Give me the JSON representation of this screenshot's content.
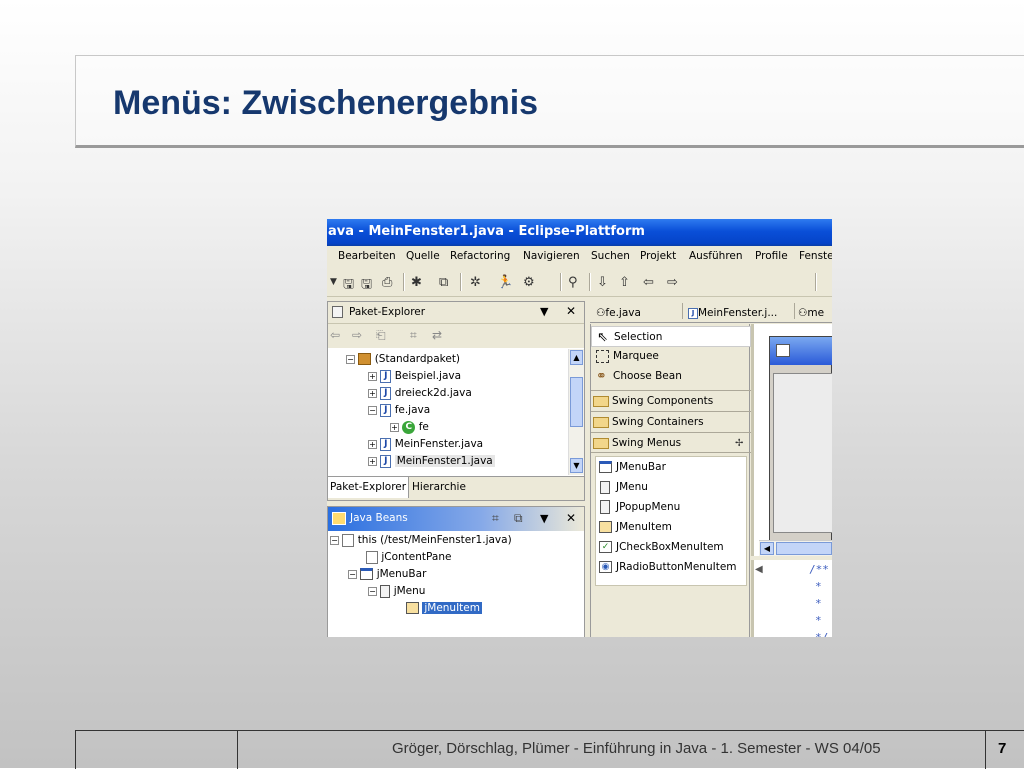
{
  "slide": {
    "title": "Menüs: Zwischenergebnis",
    "footer": "Gröger, Dörschlag, Plümer -  Einführung in Java  -  1. Semester  -  WS 04/05",
    "page_number": "7"
  },
  "eclipse": {
    "window_title": "ava - MeinFenster1.java - Eclipse-Plattform",
    "menu": [
      "Bearbeiten",
      "Quelle",
      "Refactoring",
      "Navigieren",
      "Suchen",
      "Projekt",
      "Ausführen",
      "Profile",
      "Fenste"
    ],
    "package_explorer": {
      "title": "Paket-Explorer",
      "tree": [
        {
          "label": "(Standardpaket)",
          "expander": "−",
          "icon": "package-icon"
        },
        {
          "label": "Beispiel.java",
          "expander": "+",
          "icon": "java-file-icon"
        },
        {
          "label": "dreieck2d.java",
          "expander": "+",
          "icon": "java-file-icon"
        },
        {
          "label": "fe.java",
          "expander": "−",
          "icon": "java-file-icon"
        },
        {
          "label": "fe",
          "expander": "+",
          "icon": "class-icon"
        },
        {
          "label": "MeinFenster.java",
          "expander": "+",
          "icon": "java-file-icon"
        },
        {
          "label": "MeinFenster1.java",
          "expander": "+",
          "icon": "java-file-icon"
        }
      ],
      "tabs": [
        "Paket-Explorer",
        "Hierarchie"
      ]
    },
    "java_beans": {
      "title": "Java Beans",
      "tree": [
        {
          "label": "this (/test/MeinFenster1.java)",
          "expander": "−"
        },
        {
          "label": "jContentPane",
          "expander": ""
        },
        {
          "label": "jMenuBar",
          "expander": "−"
        },
        {
          "label": "jMenu",
          "expander": "−"
        },
        {
          "label": "jMenuItem",
          "expander": "",
          "selected": true
        }
      ]
    },
    "editor_tabs": [
      "fe.java",
      "MeinFenster.j...",
      "me"
    ],
    "palette": {
      "tools": [
        "Selection",
        "Marquee",
        "Choose Bean"
      ],
      "categories": [
        "Swing Components",
        "Swing Containers",
        "Swing Menus"
      ],
      "items": [
        "JMenuBar",
        "JMenu",
        "JPopupMenu",
        "JMenuItem",
        "JCheckBoxMenuItem",
        "JRadioButtonMenuItem"
      ]
    },
    "code_lines": [
      "/**",
      "*",
      "*",
      "*",
      "*/"
    ]
  }
}
